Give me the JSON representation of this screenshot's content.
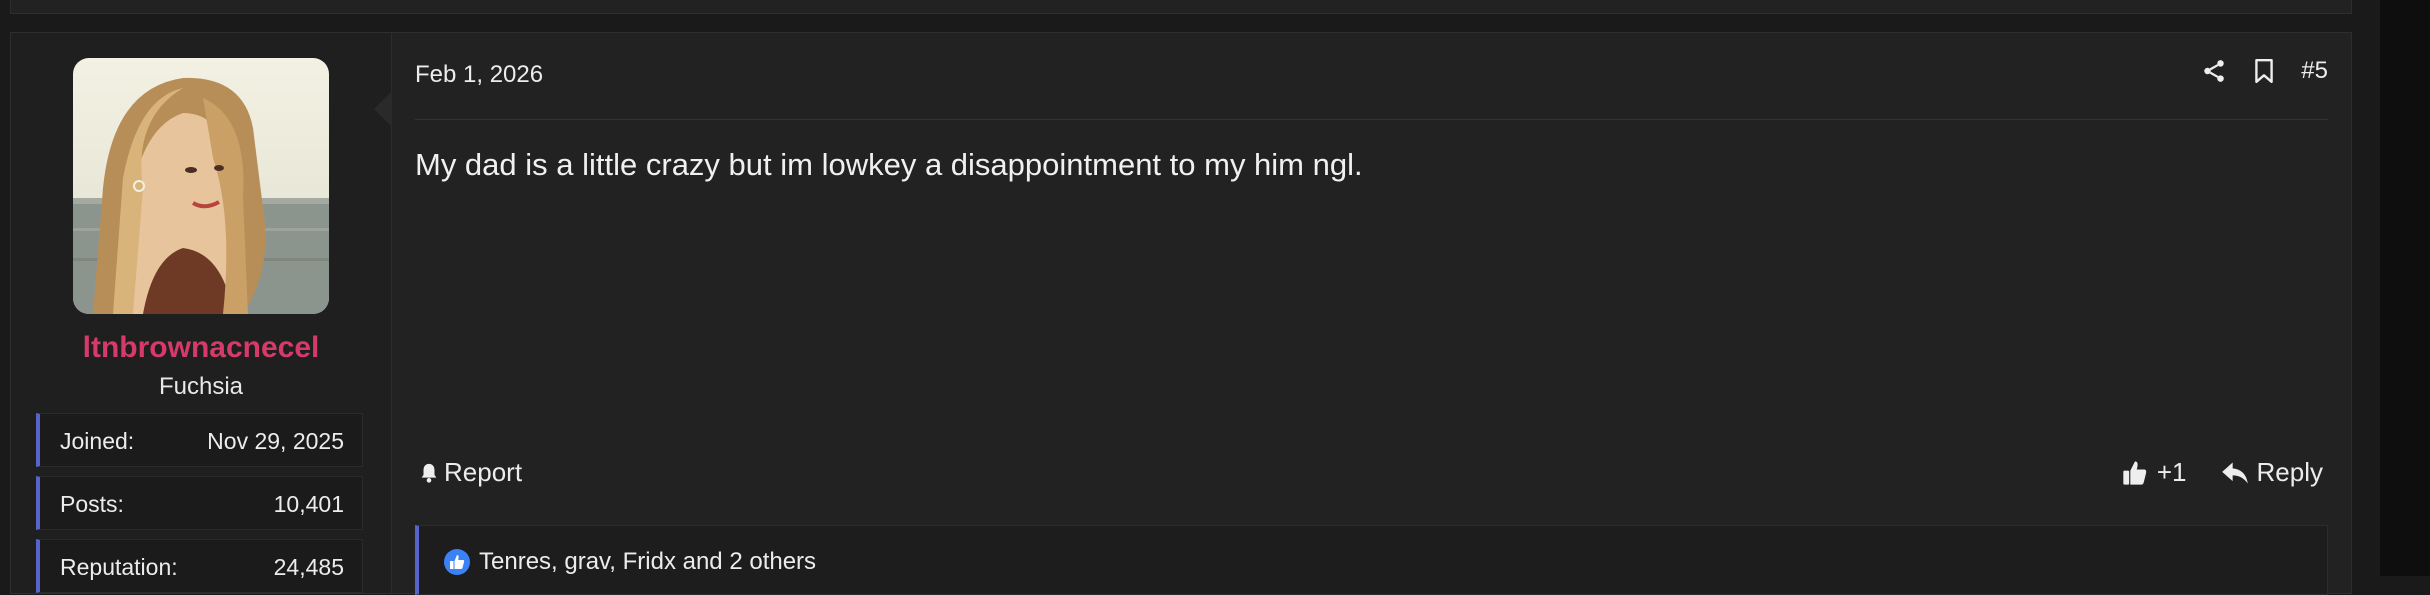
{
  "post": {
    "date": "Feb 1, 2026",
    "number": "#5",
    "message": "My dad is a little crazy but im lowkey a disappointment to my him ngl.",
    "report_label": "Report",
    "reaction_count": "+1",
    "reply_label": "Reply",
    "liked_by": "Tenres, grav, Fridx and 2 others"
  },
  "user": {
    "username": "ltnbrownacnecel",
    "title": "Fuchsia",
    "stats": [
      {
        "label": "Joined:",
        "value": "Nov 29, 2025"
      },
      {
        "label": "Posts:",
        "value": "10,401"
      },
      {
        "label": "Reputation:",
        "value": "24,485"
      }
    ]
  },
  "icons": {
    "share": "share-icon",
    "bookmark": "bookmark-icon",
    "report": "bell-icon",
    "like": "thumbs-up-icon",
    "reply": "reply-icon"
  },
  "colors": {
    "username": "#d63a6a",
    "accent": "#5865c8",
    "like_badge": "#3b82f6",
    "background": "#222222"
  }
}
